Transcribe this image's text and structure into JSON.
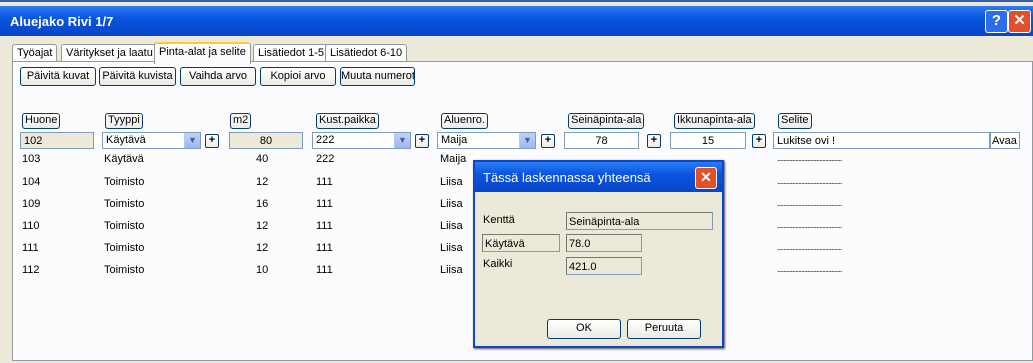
{
  "window": {
    "title": "Aluejako   Rivi 1/7",
    "help_label": "?",
    "close_label": "✕"
  },
  "tabs": [
    {
      "label": "Työajat"
    },
    {
      "label": "Väritykset ja laatu"
    },
    {
      "label": "Pinta-alat ja selite"
    },
    {
      "label": "Lisätiedot 1-5"
    },
    {
      "label": "Lisätiedot 6-10"
    }
  ],
  "toolbar": {
    "paivita_kuvat": "Päivitä kuvat",
    "paivita_kuvista": "Päivitä kuvista",
    "vaihda_arvo": "Vaihda arvo",
    "kopioi_arvo": "Kopioi arvo",
    "muuta_numerot": "Muuta numerot"
  },
  "columns": {
    "huone": "Huone",
    "tyyppi": "Tyyppi",
    "m2": "m2",
    "kustpaikka": "Kust.paikka",
    "aluenro": "Aluenro.",
    "seinapinta": "Seinäpinta-ala",
    "ikkunapinta": "Ikkunapinta-ala",
    "selite": "Selite"
  },
  "edit_row": {
    "huone": "102",
    "tyyppi": "Käytävä",
    "m2": "80",
    "kustpaikka": "222",
    "aluenro": "Maija",
    "seinapinta": "78",
    "ikkunapinta": "15",
    "selite": "Lukitse ovi !",
    "avaa_label": "Avaa",
    "plus": "+"
  },
  "rows": [
    {
      "huone": "103",
      "tyyppi": "Käytävä",
      "m2": "40",
      "kust": "222",
      "alue": "Maija",
      "selite": "..........................................."
    },
    {
      "huone": "104",
      "tyyppi": "Toimisto",
      "m2": "12",
      "kust": "111",
      "alue": "Liisa",
      "selite": "..........................................."
    },
    {
      "huone": "109",
      "tyyppi": "Toimisto",
      "m2": "16",
      "kust": "111",
      "alue": "Liisa",
      "selite": "..........................................."
    },
    {
      "huone": "110",
      "tyyppi": "Toimisto",
      "m2": "12",
      "kust": "111",
      "alue": "Liisa",
      "selite": "..........................................."
    },
    {
      "huone": "111",
      "tyyppi": "Toimisto",
      "m2": "12",
      "kust": "111",
      "alue": "Liisa",
      "selite": "..........................................."
    },
    {
      "huone": "112",
      "tyyppi": "Toimisto",
      "m2": "10",
      "kust": "111",
      "alue": "Liisa",
      "selite": "..........................................."
    }
  ],
  "dialog": {
    "title": "Tässä laskennassa yhteensä",
    "close_label": "✕",
    "kentta_label": "Kenttä",
    "kentta_value": "Seinäpinta-ala",
    "kaytava_label": "Käytävä",
    "kaytava_value": "78.0",
    "kaikki_label": "Kaikki",
    "kaikki_value": "421.0",
    "ok_label": "OK",
    "cancel_label": "Peruuta"
  }
}
